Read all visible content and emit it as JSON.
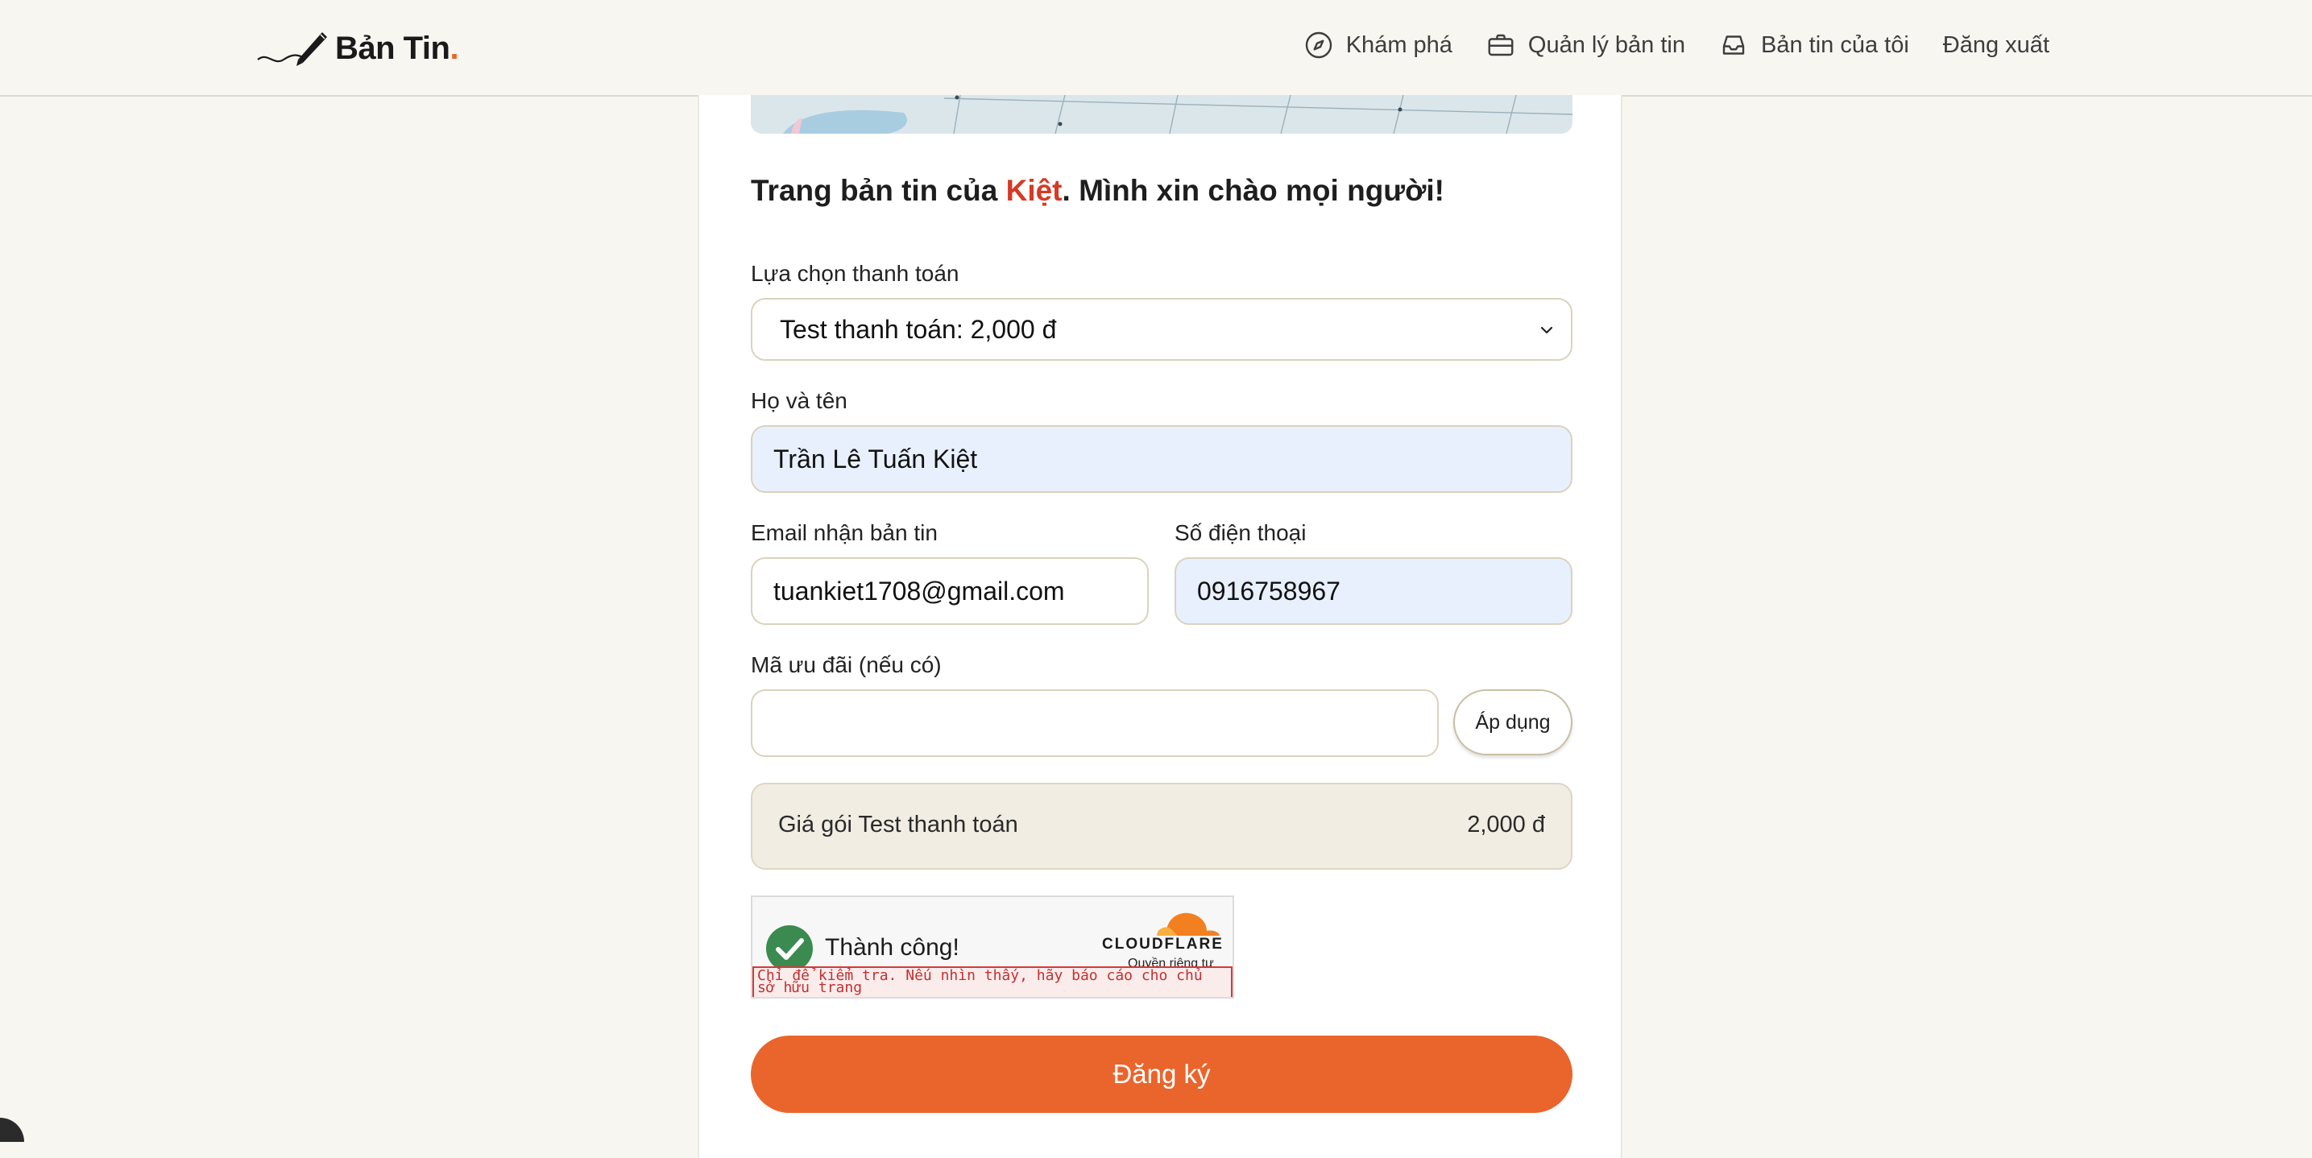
{
  "header": {
    "brand": "Bản Tin",
    "brand_dot": ".",
    "nav": [
      {
        "label": "Khám phá",
        "icon": "compass-icon"
      },
      {
        "label": "Quản lý bản tin",
        "icon": "briefcase-icon"
      },
      {
        "label": "Bản tin của tôi",
        "icon": "inbox-icon"
      },
      {
        "label": "Đăng xuất",
        "icon": ""
      }
    ]
  },
  "form": {
    "title_prefix": "Trang bản tin của ",
    "title_name": "Kiệt",
    "title_suffix": ". Mình xin chào mọi người!",
    "payment_label": "Lựa chọn thanh toán",
    "payment_value": "Test thanh toán: 2,000 đ",
    "name_label": "Họ và tên",
    "name_value": "Trần Lê Tuấn Kiệt",
    "email_label": "Email nhận bản tin",
    "email_value": "tuankiet1708@gmail.com",
    "phone_label": "Số điện thoại",
    "phone_value": "0916758967",
    "promo_label": "Mã ưu đãi (nếu có)",
    "promo_value": "",
    "apply_label": "Áp dụng",
    "price_label": "Giá gói Test thanh toán",
    "price_value": "2,000 đ",
    "submit_label": "Đăng ký"
  },
  "captcha": {
    "status": "Thành công!",
    "provider": "CLOUDFLARE",
    "privacy": "Quyền riêng tư",
    "warning": "Chỉ để kiểm tra. Nếu nhìn thấy, hãy báo cáo cho chủ sở hữu trang"
  },
  "colors": {
    "accent": "#ea652c",
    "name_highlight": "#d63a24",
    "success": "#3b8a4f",
    "autofill": "#e8f0fe",
    "background": "#f8f6f1"
  }
}
